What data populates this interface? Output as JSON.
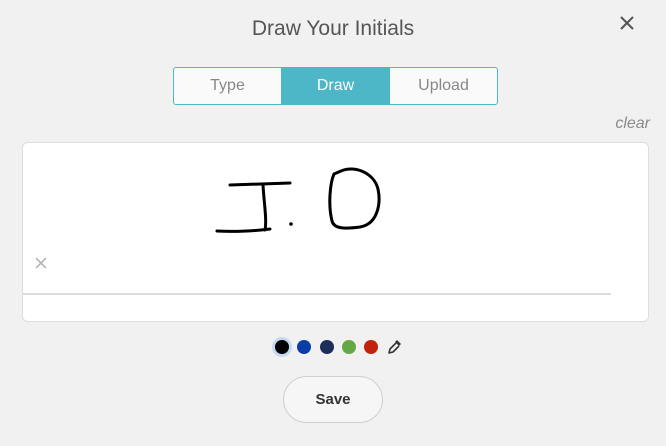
{
  "dialog": {
    "title": "Draw Your Initials",
    "close_icon": "close-icon"
  },
  "tabs": [
    {
      "label": "Type",
      "active": false
    },
    {
      "label": "Draw",
      "active": true
    },
    {
      "label": "Upload",
      "active": false
    }
  ],
  "canvas": {
    "clear_label": "clear",
    "sign_marker_icon": "x-icon"
  },
  "colors": [
    {
      "name": "black",
      "hex": "#000000",
      "selected": true
    },
    {
      "name": "blue",
      "hex": "#0a3ea6",
      "selected": false
    },
    {
      "name": "navy",
      "hex": "#1b2f5a",
      "selected": false
    },
    {
      "name": "green",
      "hex": "#64a845",
      "selected": false
    },
    {
      "name": "red",
      "hex": "#c1220e",
      "selected": false
    }
  ],
  "picker_icon": "eyedropper-icon",
  "save_label": "Save",
  "accent_color": "#4db6c7"
}
